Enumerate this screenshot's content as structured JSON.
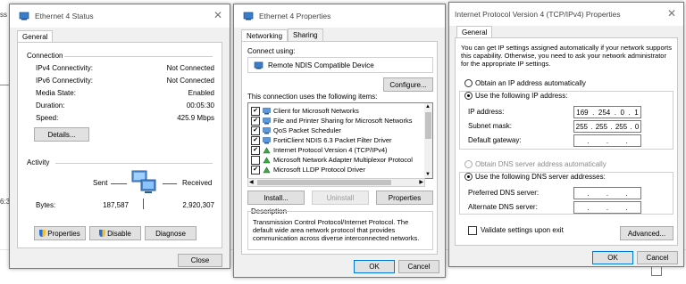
{
  "background": {
    "left_text_1": "ss",
    "left_text_2": "6:3"
  },
  "status_window": {
    "title": "Ethernet 4 Status",
    "tab": "General",
    "connection_header": "Connection",
    "rows": [
      {
        "label": "IPv4 Connectivity:",
        "value": "Not Connected"
      },
      {
        "label": "IPv6 Connectivity:",
        "value": "Not Connected"
      },
      {
        "label": "Media State:",
        "value": "Enabled"
      },
      {
        "label": "Duration:",
        "value": "00:05:30"
      },
      {
        "label": "Speed:",
        "value": "425.9 Mbps"
      }
    ],
    "details_button": "Details...",
    "activity_header": "Activity",
    "sent_label": "Sent",
    "received_label": "Received",
    "bytes_label": "Bytes:",
    "bytes_sent": "187,587",
    "bytes_received": "2,920,307",
    "properties_button": "Properties",
    "disable_button": "Disable",
    "diagnose_button": "Diagnose",
    "close_button": "Close"
  },
  "properties_window": {
    "title": "Ethernet 4 Properties",
    "tabs": [
      "Networking",
      "Sharing"
    ],
    "connect_using_label": "Connect using:",
    "adapter_name": "Remote NDIS Compatible Device",
    "configure_button": "Configure...",
    "items_label": "This connection uses the following items:",
    "items": [
      {
        "label": "Client for Microsoft Networks",
        "checked": true,
        "icon": "network-client-icon"
      },
      {
        "label": "File and Printer Sharing for Microsoft Networks",
        "checked": true,
        "icon": "network-client-icon"
      },
      {
        "label": "QoS Packet Scheduler",
        "checked": true,
        "icon": "network-client-icon"
      },
      {
        "label": "FortiClient NDIS 6.3 Packet Filter Driver",
        "checked": true,
        "icon": "network-client-icon"
      },
      {
        "label": "Internet Protocol Version 4 (TCP/IPv4)",
        "checked": true,
        "icon": "protocol-icon"
      },
      {
        "label": "Microsoft Network Adapter Multiplexor Protocol",
        "checked": false,
        "icon": "protocol-icon"
      },
      {
        "label": "Microsoft LLDP Protocol Driver",
        "checked": true,
        "icon": "protocol-icon"
      }
    ],
    "install_button": "Install...",
    "uninstall_button": "Uninstall",
    "properties_button": "Properties",
    "description_header": "Description",
    "description_text": "Transmission Control Protocol/Internet Protocol. The default wide area network protocol that provides communication across diverse interconnected networks.",
    "ok_button": "OK",
    "cancel_button": "Cancel"
  },
  "ipv4_window": {
    "title": "Internet Protocol Version 4 (TCP/IPv4) Properties",
    "tab": "General",
    "intro_text": "You can get IP settings assigned automatically if your network supports this capability. Otherwise, you need to ask your network administrator for the appropriate IP settings.",
    "obtain_ip_auto": "Obtain an IP address automatically",
    "use_following_ip": "Use the following IP address:",
    "ip_address_label": "IP address:",
    "ip_address": [
      "169",
      "254",
      "0",
      "1"
    ],
    "subnet_mask_label": "Subnet mask:",
    "subnet_mask": [
      "255",
      "255",
      "255",
      "0"
    ],
    "default_gateway_label": "Default gateway:",
    "default_gateway": [
      "",
      "",
      "",
      ""
    ],
    "obtain_dns_auto": "Obtain DNS server address automatically",
    "use_following_dns": "Use the following DNS server addresses:",
    "preferred_dns_label": "Preferred DNS server:",
    "preferred_dns": [
      "",
      "",
      "",
      ""
    ],
    "alternate_dns_label": "Alternate DNS server:",
    "alternate_dns": [
      "",
      "",
      "",
      ""
    ],
    "validate_label": "Validate settings upon exit",
    "advanced_button": "Advanced...",
    "ok_button": "OK",
    "cancel_button": "Cancel"
  }
}
